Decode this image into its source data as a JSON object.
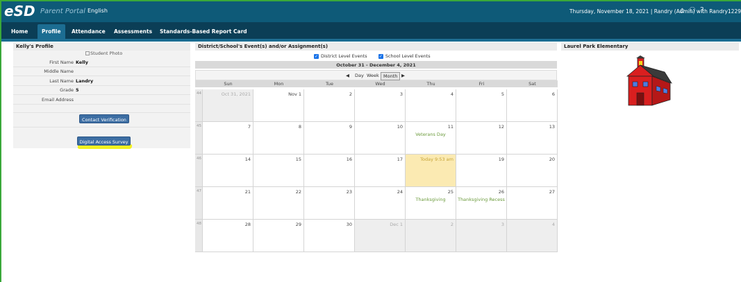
{
  "header": {
    "logo_text": "eSD",
    "portal_name": "Parent Portal",
    "language": "English",
    "greeting": "Thursday, November 18, 2021  |  Randry (Admin) with Randry1229"
  },
  "nav": {
    "tabs": [
      "Home",
      "Profile",
      "Attendance",
      "Assessments",
      "Standards-Based Report Card"
    ],
    "active": "Profile"
  },
  "profile": {
    "title": "Kelly's Profile",
    "photo_alt": "Student Photo",
    "fields": [
      {
        "label": "First Name",
        "value": "Kelly"
      },
      {
        "label": "Middle Name",
        "value": ""
      },
      {
        "label": "Last Name",
        "value": "Landry"
      },
      {
        "label": "Grade",
        "value": "5"
      },
      {
        "label": "Email Address",
        "value": ""
      }
    ],
    "contact_button": "Contact Verification",
    "survey_button": "Digital Access Survey"
  },
  "events": {
    "title": "District/School's Event(s) and/or Assignment(s)",
    "district_label": "District Level Events",
    "school_label": "School Level Events",
    "range": "October 31 - December 4, 2021",
    "views": [
      "Day",
      "Week",
      "Month"
    ],
    "active_view": "Month",
    "weekdays": [
      "Sun",
      "Mon",
      "Tue",
      "Wed",
      "Thu",
      "Fri",
      "Sat"
    ],
    "weeks": [
      {
        "wk": "44",
        "days": [
          "Oct 31, 2021",
          "Nov 1",
          "2",
          "3",
          "4",
          "5",
          "6"
        ],
        "other": [
          0
        ]
      },
      {
        "wk": "45",
        "days": [
          "7",
          "8",
          "9",
          "10",
          "11",
          "12",
          "13"
        ],
        "other": []
      },
      {
        "wk": "46",
        "days": [
          "14",
          "15",
          "16",
          "17",
          "Today 9:53 am",
          "19",
          "20"
        ],
        "other": [],
        "today": 4
      },
      {
        "wk": "47",
        "days": [
          "21",
          "22",
          "23",
          "24",
          "25",
          "26",
          "27"
        ],
        "other": []
      },
      {
        "wk": "48",
        "days": [
          "28",
          "29",
          "30",
          "Dec 1",
          "2",
          "3",
          "4"
        ],
        "other": [
          3,
          4,
          5,
          6
        ]
      }
    ],
    "events": [
      {
        "week": 1,
        "day": 4,
        "label": "Veterans Day"
      },
      {
        "week": 3,
        "day": 4,
        "label": "Thanksgiving"
      },
      {
        "week": 3,
        "day": 5,
        "label": "Thanksgiving Recess"
      }
    ]
  },
  "school": {
    "name": "Laurel Park Elementary",
    "colors": {
      "wall": "#d91f1f",
      "roof": "#3a3a3a",
      "window": "#4f7be0",
      "bell": "#f2d31a"
    }
  },
  "colors": {
    "topbar": "#0e5a78",
    "navbar": "#0b3e56",
    "active_tab": "#1c6d92",
    "event_text": "#6a9a3a",
    "today": "#fbeab2"
  }
}
